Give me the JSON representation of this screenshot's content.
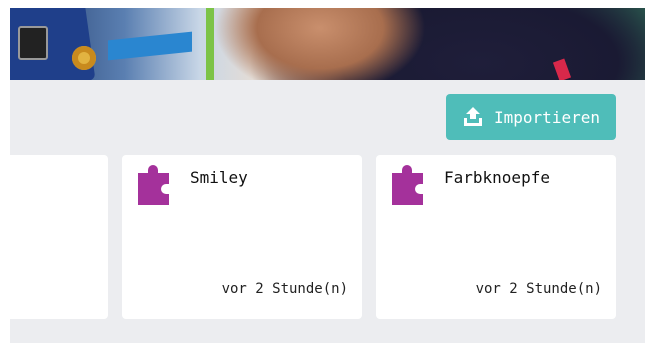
{
  "header": {
    "banner_image": "electronics-photo-banner"
  },
  "toolbar": {
    "import_label": "Importieren",
    "import_icon": "upload-icon"
  },
  "projects": [
    {
      "title": "Smiley",
      "modified": "vor 2 Stunde(n)",
      "icon": "puzzle-icon"
    },
    {
      "title": "Farbknoepfe",
      "modified": "vor 2 Stunde(n)",
      "icon": "puzzle-icon"
    }
  ],
  "colors": {
    "accent": "#4fbdb9",
    "puzzle": "#a4319b",
    "background": "#ecedf0",
    "card": "#ffffff"
  }
}
